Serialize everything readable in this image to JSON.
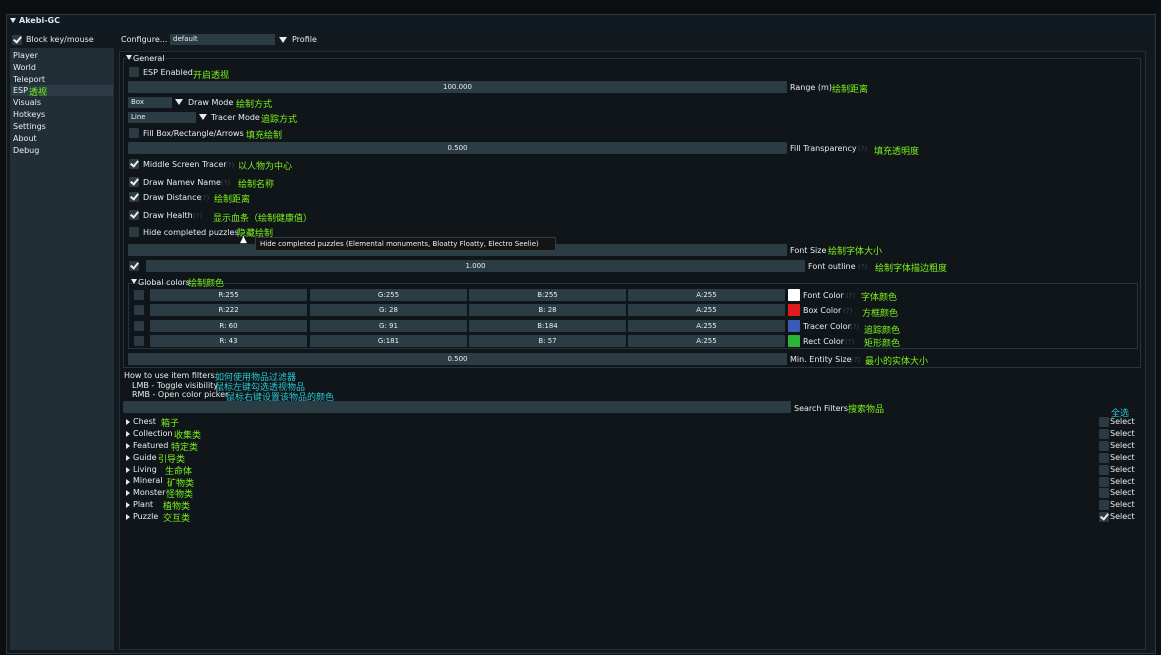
{
  "window": {
    "title": "Akebi-GC"
  },
  "topbar": {
    "block_label": "Block key/mouse",
    "configure_label": "Configure...",
    "profile_value": "default",
    "profile_label": "Profile"
  },
  "sidebar": {
    "items": [
      "Player",
      "World",
      "Teleport",
      "ESP",
      "Visuals",
      "Hotkeys",
      "Settings",
      "About",
      "Debug"
    ],
    "esp_cn": "透视"
  },
  "general": {
    "header": "General",
    "esp_enabled": {
      "label": "ESP Enabled",
      "cn": "开启透视",
      "checked": false
    },
    "range": {
      "value": "100.000",
      "label": "Range (m)",
      "cn": "绘制距离"
    },
    "draw_mode": {
      "value": "Box",
      "label": "Draw Mode",
      "cn": "绘制方式"
    },
    "tracer_mode": {
      "value": "Line",
      "label": "Tracer Mode",
      "cn": "追踪方式"
    },
    "fill_box": {
      "label": "Fill Box/Rectangle/Arrows",
      "cn": "填充绘制",
      "checked": false
    },
    "fill_transparency": {
      "value": "0.500",
      "label": "Fill Transparency",
      "hint": "(?)",
      "cn": "填充透明度"
    },
    "middle_tracer": {
      "label": "Middle Screen Tracer",
      "hint": "(?)",
      "cn": "以人物为中心",
      "checked": true
    },
    "draw_name": {
      "label": "Draw Namev Name",
      "hint": "(?)",
      "cn": "绘制名称",
      "checked": true
    },
    "draw_distance": {
      "label": "Draw Distance",
      "hint": "(?)",
      "cn": "绘制距离",
      "checked": true
    },
    "draw_health": {
      "label": "Draw Health",
      "hint": "(?)",
      "cn": "显示血条（绘制健康值）",
      "checked": true
    },
    "hide_completed": {
      "label": "Hide completed puzzles",
      "hint": "(?)",
      "cn": "隐藏绘制",
      "checked": false
    },
    "font_size": {
      "label": "Font Size",
      "cn": "绘制字体大小"
    },
    "font_outline": {
      "value": "1.000",
      "label": "Font outline",
      "hint": "(?)",
      "cn": "绘制字体描边粗度",
      "checked": true
    }
  },
  "tooltip": "Hide completed puzzles (Elemental monuments, Bloatty Floatty, Electro Seelie)",
  "global_colors": {
    "header": "Global colors",
    "cn": "绘制颜色",
    "rows": [
      {
        "r": "R:255",
        "g": "G:255",
        "b": "B:255",
        "a": "A:255",
        "color": "#ffffff",
        "label": "Font Color",
        "hint": "(?)",
        "cn": "字体颜色"
      },
      {
        "r": "R:222",
        "g": "G: 28",
        "b": "B: 28",
        "a": "A:255",
        "color": "#de1c1c",
        "label": "Box Color",
        "hint": "(?)",
        "cn": "方框颜色"
      },
      {
        "r": "R: 60",
        "g": "G: 91",
        "b": "B:184",
        "a": "A:255",
        "color": "#3c5bb8",
        "label": "Tracer Color",
        "hint": "(?)",
        "cn": "追踪颜色"
      },
      {
        "r": "R: 43",
        "g": "G:181",
        "b": "B: 57",
        "a": "A:255",
        "color": "#2bb539",
        "label": "Rect Color",
        "hint": "(?)",
        "cn": "矩形颜色"
      }
    ],
    "min_entity": {
      "value": "0.500",
      "label": "Min. Entity Size",
      "hint": "(?)",
      "cn": "最小的实体大小"
    }
  },
  "help": {
    "line1": "How to use item filters:",
    "line1_cn": "如何使用物品过滤器",
    "line2": "LMB - Toggle visibility",
    "line2_cn": "鼠标左键勾选透视物品",
    "line3": "RMB - Open color picker",
    "line3_cn": "鼠标右键设置该物品的颜色"
  },
  "search": {
    "label": "Search Filters",
    "cn": "搜索物品"
  },
  "select_all_cn": "全选",
  "categories": [
    {
      "label": "Chest",
      "cn": "箱子",
      "select": "Select",
      "checked": false
    },
    {
      "label": "Collection",
      "cn": "收集类",
      "select": "Select",
      "checked": false
    },
    {
      "label": "Featured",
      "cn": "特定类",
      "select": "Select",
      "checked": false
    },
    {
      "label": "Guide",
      "cn": "引导类",
      "select": "Select",
      "checked": false
    },
    {
      "label": "Living",
      "cn": "生命体",
      "select": "Select",
      "checked": false
    },
    {
      "label": "Mineral",
      "cn": "矿物类",
      "select": "Select",
      "checked": false
    },
    {
      "label": "Monster",
      "cn": "怪物类",
      "select": "Select",
      "checked": false
    },
    {
      "label": "Plant",
      "cn": "植物类",
      "select": "Select",
      "checked": false
    },
    {
      "label": "Puzzle",
      "cn": "交互类",
      "select": "Select",
      "checked": true
    }
  ]
}
